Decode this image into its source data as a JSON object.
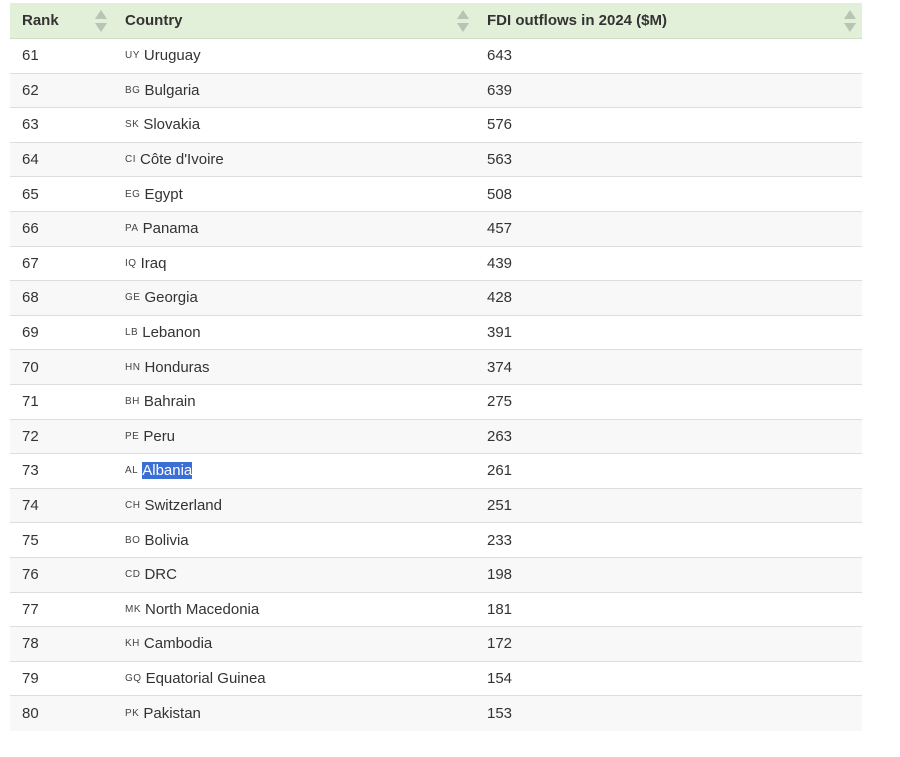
{
  "table": {
    "columns": [
      "Rank",
      "Country",
      "FDI outflows in 2024 ($M)"
    ],
    "selected_text": "Albania",
    "rows": [
      {
        "rank": "61",
        "code": "UY",
        "country": "Uruguay",
        "value": "643"
      },
      {
        "rank": "62",
        "code": "BG",
        "country": "Bulgaria",
        "value": "639"
      },
      {
        "rank": "63",
        "code": "SK",
        "country": "Slovakia",
        "value": "576"
      },
      {
        "rank": "64",
        "code": "CI",
        "country": "Côte d'Ivoire",
        "value": "563"
      },
      {
        "rank": "65",
        "code": "EG",
        "country": "Egypt",
        "value": "508"
      },
      {
        "rank": "66",
        "code": "PA",
        "country": "Panama",
        "value": "457"
      },
      {
        "rank": "67",
        "code": "IQ",
        "country": "Iraq",
        "value": "439"
      },
      {
        "rank": "68",
        "code": "GE",
        "country": "Georgia",
        "value": "428"
      },
      {
        "rank": "69",
        "code": "LB",
        "country": "Lebanon",
        "value": "391"
      },
      {
        "rank": "70",
        "code": "HN",
        "country": "Honduras",
        "value": "374"
      },
      {
        "rank": "71",
        "code": "BH",
        "country": "Bahrain",
        "value": "275"
      },
      {
        "rank": "72",
        "code": "PE",
        "country": "Peru",
        "value": "263"
      },
      {
        "rank": "73",
        "code": "AL",
        "country": "Albania",
        "value": "261"
      },
      {
        "rank": "74",
        "code": "CH",
        "country": "Switzerland",
        "value": "251"
      },
      {
        "rank": "75",
        "code": "BO",
        "country": "Bolivia",
        "value": "233"
      },
      {
        "rank": "76",
        "code": "CD",
        "country": "DRC",
        "value": "198"
      },
      {
        "rank": "77",
        "code": "MK",
        "country": "North Macedonia",
        "value": "181"
      },
      {
        "rank": "78",
        "code": "KH",
        "country": "Cambodia",
        "value": "172"
      },
      {
        "rank": "79",
        "code": "GQ",
        "country": "Equatorial Guinea",
        "value": "154"
      },
      {
        "rank": "80",
        "code": "PK",
        "country": "Pakistan",
        "value": "153"
      }
    ]
  },
  "colors": {
    "header_bg": "#e2efd9",
    "selection": "#3b6fd6"
  }
}
